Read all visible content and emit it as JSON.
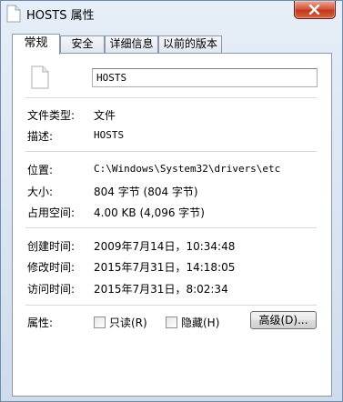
{
  "window": {
    "title": "HOSTS 属性"
  },
  "tabs": [
    {
      "label": "常规"
    },
    {
      "label": "安全"
    },
    {
      "label": "详细信息"
    },
    {
      "label": "以前的版本"
    }
  ],
  "general": {
    "file_name": "HOSTS",
    "rows": [
      {
        "label": "文件类型:",
        "value": "文件"
      },
      {
        "label": "描述:",
        "value": "HOSTS"
      },
      {
        "label": "位置:",
        "value": "C:\\Windows\\System32\\drivers\\etc"
      },
      {
        "label": "大小:",
        "value": "804 字节 (804 字节)"
      },
      {
        "label": "占用空间:",
        "value": "4.00 KB (4,096 字节)"
      },
      {
        "label": "创建时间:",
        "value": "2009年7月14日，10:34:48"
      },
      {
        "label": "修改时间:",
        "value": "2015年7月31日，14:18:05"
      },
      {
        "label": "访问时间:",
        "value": "2015年7月31日，8:02:34"
      }
    ],
    "attributes": {
      "label": "属性:",
      "readonly_label": "只读(R)",
      "hidden_label": "隐藏(H)",
      "advanced_label": "高级(D)..."
    }
  }
}
